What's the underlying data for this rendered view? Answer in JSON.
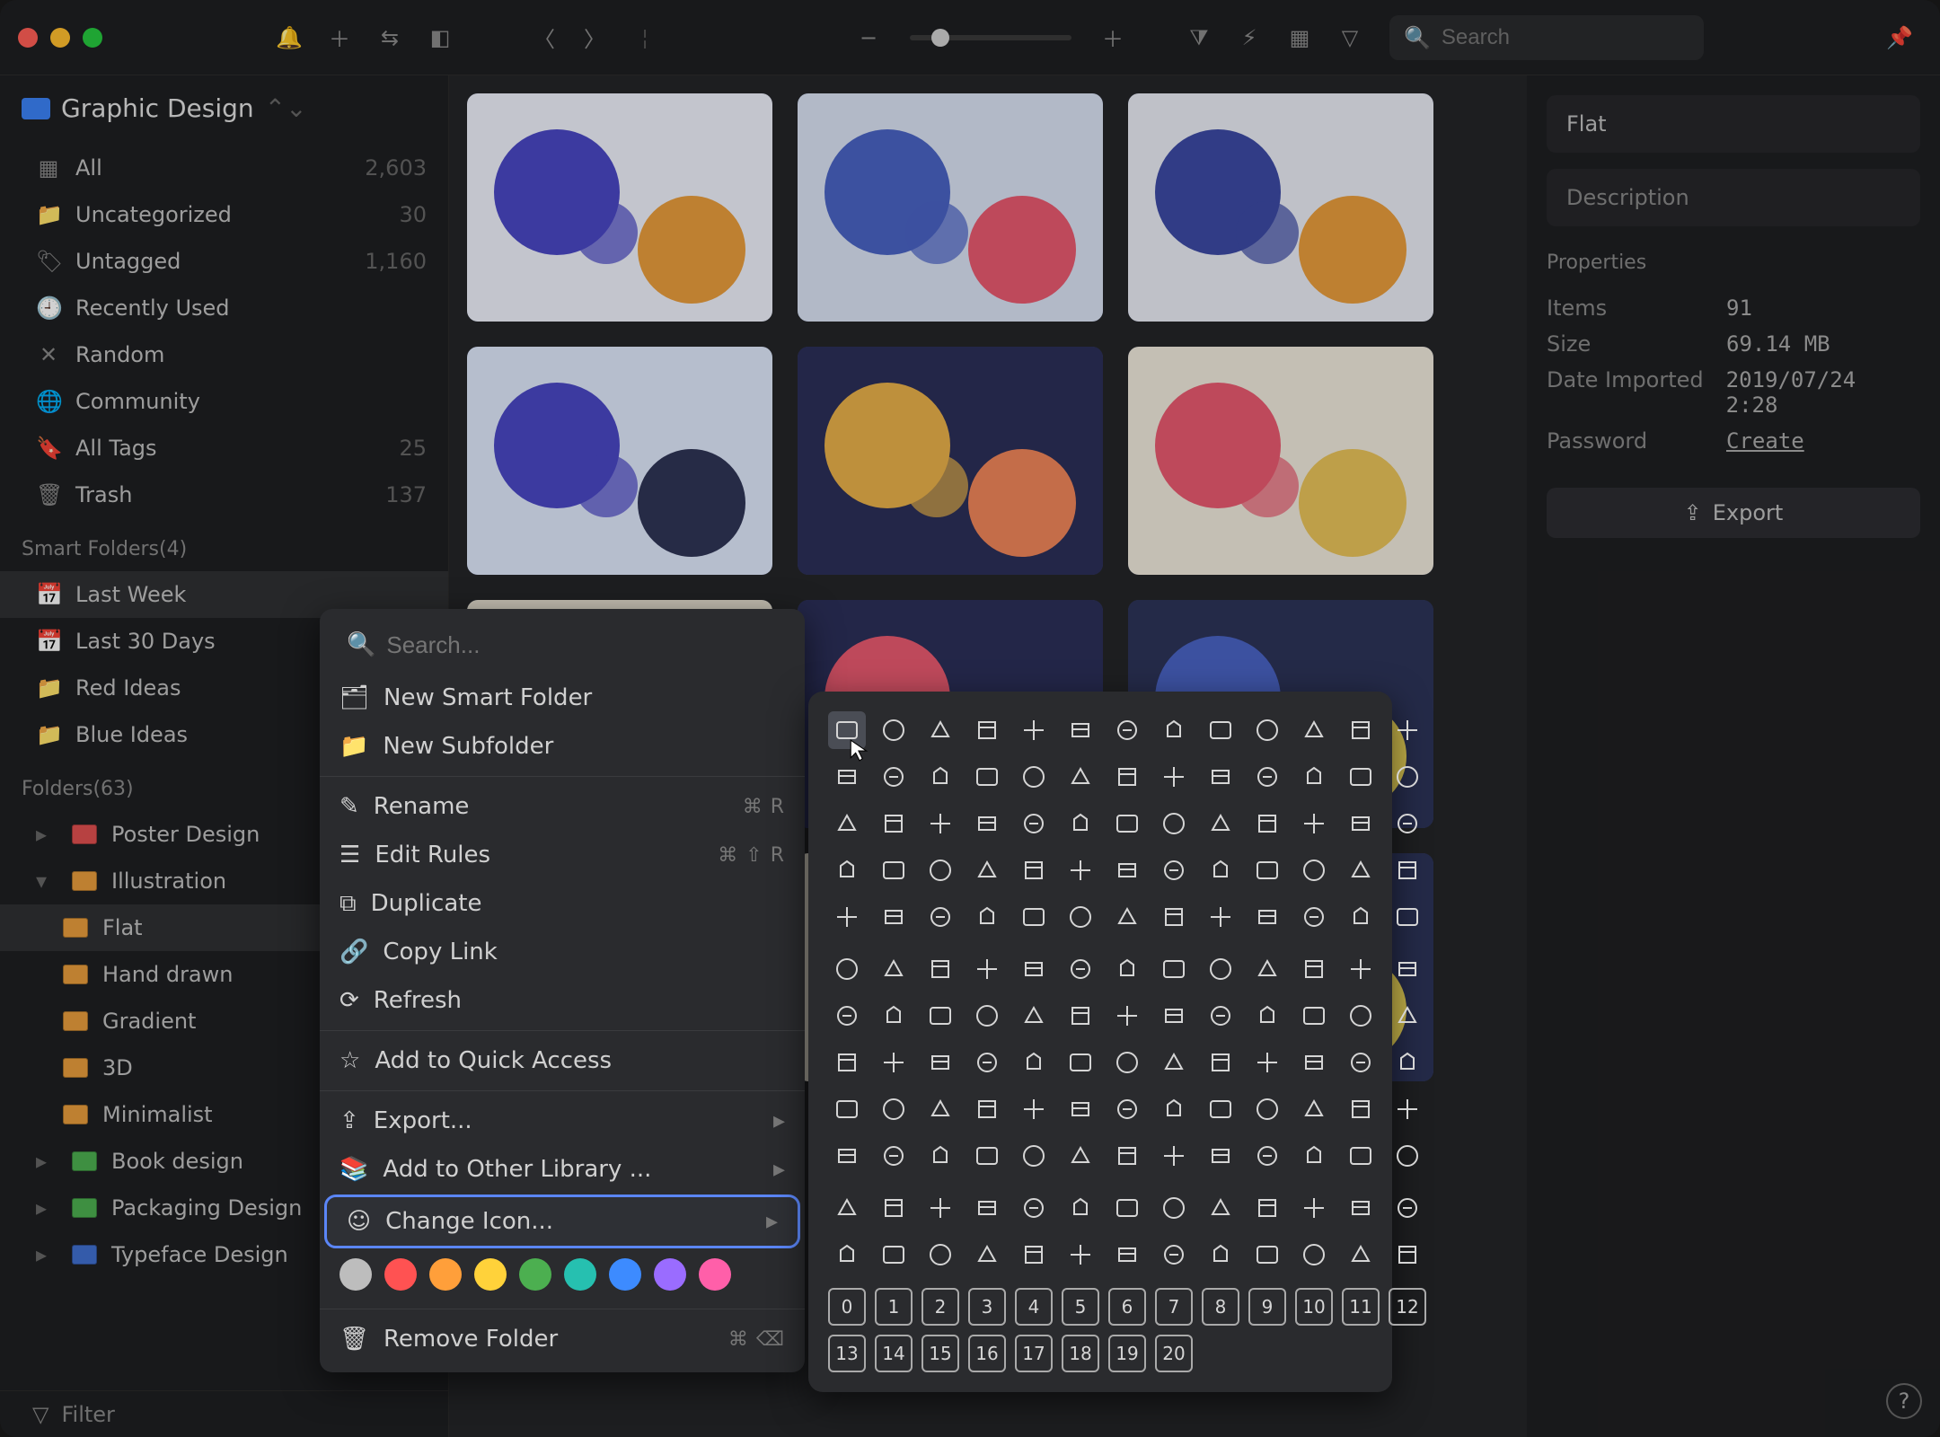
{
  "library_name": "Graphic Design",
  "search_placeholder": "Search",
  "sidebar": {
    "fixed": [
      {
        "icon": "grid",
        "label": "All",
        "count": "2,603"
      },
      {
        "icon": "folder",
        "label": "Uncategorized",
        "count": "30"
      },
      {
        "icon": "tag",
        "label": "Untagged",
        "count": "1,160"
      },
      {
        "icon": "clock",
        "label": "Recently Used",
        "count": ""
      },
      {
        "icon": "shuffle",
        "label": "Random",
        "count": ""
      },
      {
        "icon": "globe",
        "label": "Community",
        "count": ""
      },
      {
        "icon": "bookmark",
        "label": "All Tags",
        "count": "25"
      },
      {
        "icon": "trash",
        "label": "Trash",
        "count": "137"
      }
    ],
    "smart_header": "Smart Folders(4)",
    "smart": [
      {
        "icon": "cal7",
        "label": "Last Week",
        "selected": true
      },
      {
        "icon": "cal31",
        "label": "Last 30 Days"
      },
      {
        "icon": "folder",
        "label": "Red Ideas",
        "color": "red"
      },
      {
        "icon": "folder",
        "label": "Blue Ideas",
        "color": "blue"
      }
    ],
    "folders_header": "Folders(63)",
    "folders": [
      {
        "label": "Poster Design",
        "color": "red",
        "expandable": true
      },
      {
        "label": "Illustration",
        "color": "orange",
        "expanded": true,
        "children": [
          {
            "label": "Flat",
            "color": "orange",
            "selected": true
          },
          {
            "label": "Hand drawn",
            "color": "orange"
          },
          {
            "label": "Gradient",
            "color": "orange"
          },
          {
            "label": "3D",
            "color": "orange"
          },
          {
            "label": "Minimalist",
            "color": "orange"
          }
        ]
      },
      {
        "label": "Book design",
        "color": "green",
        "expandable": true
      },
      {
        "label": "Packaging Design",
        "color": "green",
        "expandable": true
      },
      {
        "label": "Typeface Design",
        "color": "blue",
        "expandable": true
      }
    ],
    "filter_label": "Filter"
  },
  "inspector": {
    "title": "Flat",
    "description_placeholder": "Description",
    "properties_label": "Properties",
    "props": [
      {
        "k": "Items",
        "v": "91"
      },
      {
        "k": "Size",
        "v": "69.14 MB"
      },
      {
        "k": "Date Imported",
        "v": "2019/07/24 2:28"
      },
      {
        "k": "Password",
        "v": "Create",
        "link": true
      }
    ],
    "export_label": "Export"
  },
  "context_menu": {
    "search_placeholder": "Search...",
    "items": [
      {
        "icon": "smart-folder",
        "label": "New Smart Folder"
      },
      {
        "icon": "subfolder",
        "label": "New Subfolder"
      },
      {
        "sep": true
      },
      {
        "icon": "rename",
        "label": "Rename",
        "shortcut": "⌘ R"
      },
      {
        "icon": "rules",
        "label": "Edit Rules",
        "shortcut": "⌘ ⇧ R"
      },
      {
        "icon": "duplicate",
        "label": "Duplicate"
      },
      {
        "icon": "link",
        "label": "Copy Link"
      },
      {
        "icon": "refresh",
        "label": "Refresh"
      },
      {
        "sep": true
      },
      {
        "icon": "star",
        "label": "Add to Quick Access"
      },
      {
        "sep": true
      },
      {
        "icon": "export",
        "label": "Export...",
        "submenu": true
      },
      {
        "icon": "library",
        "label": "Add to Other Library ...",
        "submenu": true
      },
      {
        "icon": "smile",
        "label": "Change Icon...",
        "submenu": true,
        "highlight": true
      },
      {
        "colors": [
          "#bdbdbd",
          "#ff5252",
          "#ff9f3a",
          "#ffd23a",
          "#4caf50",
          "#26c0b0",
          "#3d8bff",
          "#9a6cff",
          "#ff5fa9"
        ]
      },
      {
        "sep": true
      },
      {
        "icon": "remove",
        "label": "Remove Folder",
        "shortcut": "⌘ ⌫"
      }
    ]
  },
  "icon_picker": {
    "selected_index": 0,
    "row_count_section1": 5,
    "row_count_section2": 5,
    "row_count_section3": 2,
    "numbers": [
      "0",
      "1",
      "2",
      "3",
      "4",
      "5",
      "6",
      "7",
      "8",
      "9",
      "10",
      "11",
      "12",
      "13",
      "14",
      "15",
      "16",
      "17",
      "18",
      "19",
      "20"
    ]
  }
}
